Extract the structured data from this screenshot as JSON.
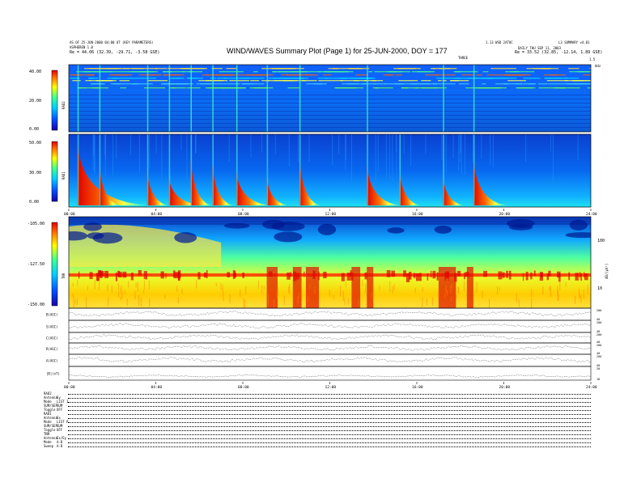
{
  "header": {
    "title": "WIND/WAVES Summary Plot (Page 1) for 25-JUN-2000, DOY = 177",
    "left_line1": "Re =  44.06 (32.39, -29.71, -3.58 GSE)",
    "right_line1": "Re =  33.52 (32.85, -12.14, 1.89 GSE)",
    "left_small1": "AS OF 25-JUN-2000 04:00 UT (KEY PARAMETERS)",
    "left_small2": "ASPHEREN 1.0",
    "right_small1": "1.13 WSD 2ATOC",
    "right_small2": "DAILY THU SEP 11, 2003",
    "right_small3": "L3 SUMMARY v4.01",
    "right_small4": "THREE",
    "right_small5": "kHz",
    "axis_right_top": "1.5"
  },
  "panels": {
    "rad2": {
      "label": "RAD2",
      "ticks": [
        "40.00",
        "20.00",
        "0.00"
      ]
    },
    "rad1": {
      "label": "RAD1",
      "ticks": [
        "50.00",
        "30.00",
        "0.00"
      ]
    },
    "tnr": {
      "label": "TNR",
      "ticks": [
        "-105.00",
        "-127.50",
        "-150.00"
      ],
      "right_ticks": [
        "100",
        "10"
      ],
      "right_label": "dB/(μV²)"
    },
    "mid_time_ticks": [
      "00:00",
      "04:00",
      "08:00",
      "12:00",
      "16:00",
      "20:00",
      "24:00"
    ],
    "bottom_time_ticks": [
      "00:00",
      "04:00",
      "08:00",
      "12:00",
      "16:00",
      "20:00",
      "24:00"
    ],
    "lines": [
      {
        "label": "B(AGC)",
        "scale": [
          "200",
          "40"
        ]
      },
      {
        "label": "S(AGC)",
        "scale": [
          "200",
          "40"
        ]
      },
      {
        "label": "C(AGC)",
        "scale": [
          "200",
          "40"
        ]
      },
      {
        "label": "R(AGC)",
        "scale": [
          "200",
          "40"
        ]
      },
      {
        "label": "A(AGC)",
        "scale": [
          "200",
          "40"
        ]
      },
      {
        "label": "|B|(nT)",
        "scale": [
          "20",
          "10"
        ]
      }
    ]
  },
  "settings": [
    {
      "k": "RAD2",
      "v": ""
    },
    {
      "k": "Antenna",
      "v": "Ey"
    },
    {
      "k": "Mode",
      "v": "LIST I"
    },
    {
      "k": "SUM/SEP",
      "v": "SUM"
    },
    {
      "k": "Toggle",
      "v": "OFF"
    },
    {
      "k": "RAD1",
      "v": ""
    },
    {
      "k": "Antenna",
      "v": "Ex"
    },
    {
      "k": "Mode",
      "v": "LIST P"
    },
    {
      "k": "SUM/SEP",
      "v": "SUM"
    },
    {
      "k": "Toggle",
      "v": "OFF"
    },
    {
      "k": "TNR",
      "v": ""
    },
    {
      "k": "Antenna",
      "v": "Ex/Ey"
    },
    {
      "k": "Mode",
      "v": "A-D"
    },
    {
      "k": "Sweep",
      "v": "A-D"
    }
  ],
  "chart_data": [
    {
      "type": "heatmap",
      "title": "WIND/WAVES Summary Plot (Page 1) for 25-JUN-2000, DOY = 177",
      "panel": "RAD2",
      "x_range_hours": [
        0,
        24
      ],
      "y_ticks": [
        0,
        20,
        40
      ],
      "colormap": "rainbow (blue-low, red-high)",
      "burst_hours": [
        0.4,
        1.4,
        3.6,
        4.6,
        5.6,
        6.6,
        7.7,
        9.1,
        10.6,
        13.7,
        17.2,
        18.6
      ]
    },
    {
      "type": "heatmap",
      "panel": "RAD1",
      "x_range_hours": [
        0,
        24
      ],
      "y_ticks": [
        0,
        30,
        50
      ],
      "burst_hours": [
        0.4,
        1.4,
        3.6,
        4.6,
        5.6,
        6.6,
        7.7,
        9.1,
        10.6,
        13.7,
        15.2,
        17.2,
        18.6
      ]
    },
    {
      "type": "heatmap",
      "panel": "TNR",
      "x_range_hours": [
        0,
        24
      ],
      "y_ticks": [
        -150,
        -127.5,
        -105
      ],
      "right_ticks_khz": [
        10,
        100
      ]
    },
    {
      "type": "line",
      "panel": "AGC and |B| traces",
      "series": [
        {
          "name": "B(AGC)"
        },
        {
          "name": "S(AGC)"
        },
        {
          "name": "C(AGC)"
        },
        {
          "name": "R(AGC)"
        },
        {
          "name": "A(AGC)"
        },
        {
          "name": "|B|(nT)"
        }
      ]
    }
  ]
}
